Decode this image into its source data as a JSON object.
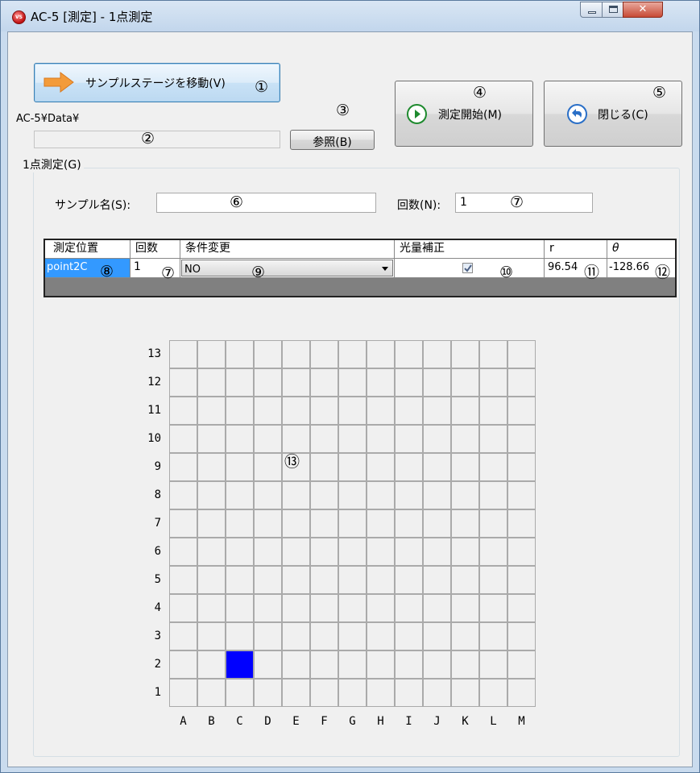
{
  "window": {
    "title": "AC-5 [測定] - 1点測定",
    "app_icon_text": "VS",
    "close_glyph": "✕"
  },
  "toolbar": {
    "move_stage_label": "サンプルステージを移動(V)",
    "path_label": "AC-5¥Data¥",
    "path_value": "",
    "browse_label": "参照(B)",
    "start_label": "測定開始(M)",
    "close_label": "閉じる(C)"
  },
  "group": {
    "title": "1点測定(G)",
    "sample_name_label": "サンプル名(S):",
    "sample_name_value": "",
    "count_label": "回数(N):",
    "count_value": "1"
  },
  "table": {
    "headers": [
      "測定位置",
      "回数",
      "条件変更",
      "光量補正",
      "r",
      "θ"
    ],
    "row": {
      "position": "point2C",
      "count": "1",
      "condition": "NO",
      "light_correction": true,
      "r": "96.54",
      "theta": "-128.66"
    }
  },
  "plate": {
    "rows": [
      "13",
      "12",
      "11",
      "10",
      "9",
      "8",
      "7",
      "6",
      "5",
      "4",
      "3",
      "2",
      "1"
    ],
    "cols": [
      "A",
      "B",
      "C",
      "D",
      "E",
      "F",
      "G",
      "H",
      "I",
      "J",
      "K",
      "L",
      "M"
    ],
    "selected": {
      "row": "2",
      "col": "C"
    },
    "selected_color": "#0000ff"
  },
  "annotations": [
    "①",
    "②",
    "③",
    "④",
    "⑤",
    "⑥",
    "⑦",
    "⑦",
    "⑧",
    "⑨",
    "⑩",
    "⑪",
    "⑫",
    "⑬"
  ],
  "colors": {
    "accent": "#3399ff",
    "arrow": "#f39b3a",
    "play_icon": "#1e8a2e",
    "back_icon": "#2a6fc7"
  }
}
